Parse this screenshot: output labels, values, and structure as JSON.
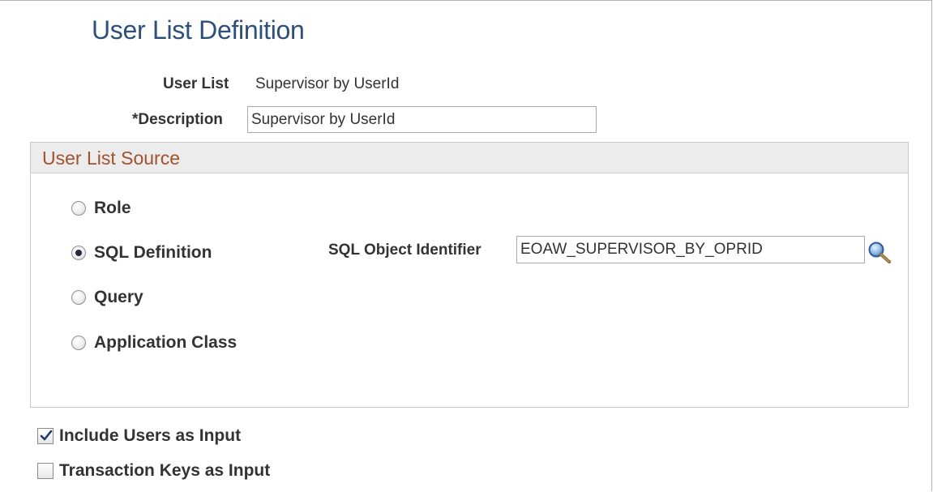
{
  "page": {
    "title": "User List Definition"
  },
  "fields": {
    "user_list": {
      "label": "User List",
      "value": "Supervisor by UserId"
    },
    "description": {
      "label": "*Description",
      "value": "Supervisor by UserId"
    }
  },
  "source_group": {
    "title": "User List Source",
    "options": [
      {
        "label": "Role",
        "selected": false
      },
      {
        "label": "SQL Definition",
        "selected": true
      },
      {
        "label": "Query",
        "selected": false
      },
      {
        "label": "Application Class",
        "selected": false
      }
    ],
    "sql_object": {
      "label": "SQL Object Identifier",
      "value": "EOAW_SUPERVISOR_BY_OPRID",
      "lookup_icon": "magnifier-icon"
    }
  },
  "options": {
    "include_users": {
      "label": "Include Users as Input",
      "checked": true
    },
    "transaction_keys": {
      "label": "Transaction Keys as Input",
      "checked": false
    }
  },
  "colors": {
    "title": "#2e4f7a",
    "group_title": "#a0522d",
    "group_header_bg": "#ececec",
    "text": "#333333"
  }
}
